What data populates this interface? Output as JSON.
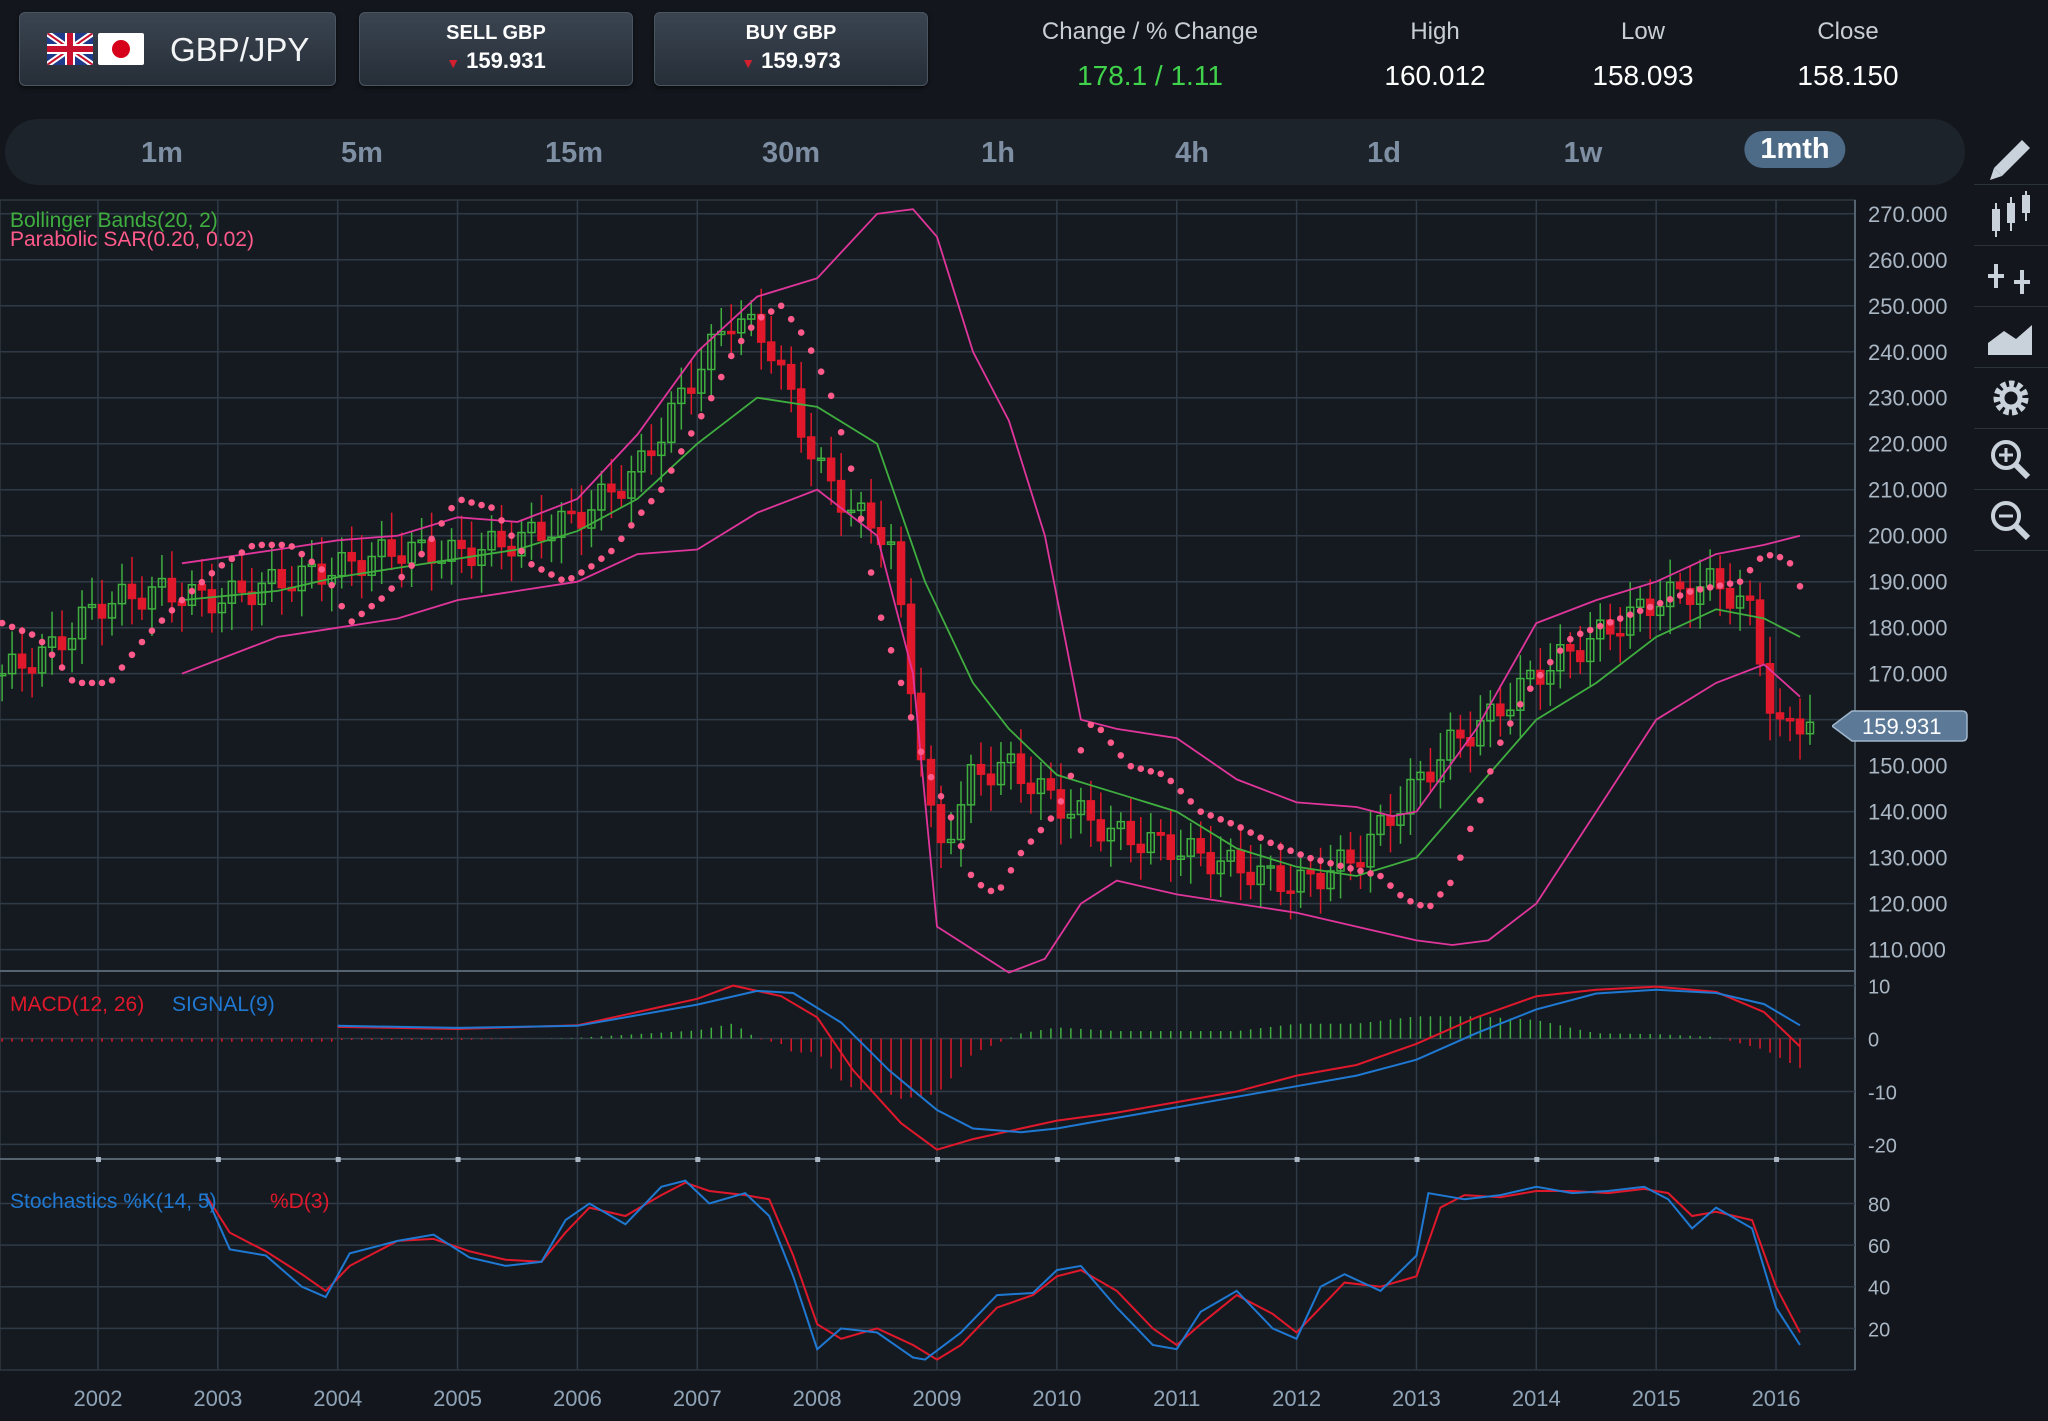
{
  "header": {
    "pair": "GBP/JPY",
    "sell_label": "SELL GBP",
    "sell_price": "159.931",
    "buy_label": "BUY GBP",
    "buy_price": "159.973",
    "change_label": "Change / % Change",
    "change_value": "178.1 / 1.11",
    "high_label": "High",
    "high_value": "160.012",
    "low_label": "Low",
    "low_value": "158.093",
    "close_label": "Close",
    "close_value": "158.150"
  },
  "timeframes": [
    "1m",
    "5m",
    "15m",
    "30m",
    "1h",
    "4h",
    "1d",
    "1w",
    "1mth"
  ],
  "active_timeframe": "1mth",
  "tools": [
    "pencil-icon",
    "candlestick-icon",
    "crosshair-icon",
    "area-chart-icon",
    "gear-icon",
    "zoom-in-icon",
    "zoom-out-icon"
  ],
  "colors": {
    "up": "#3fae3f",
    "down": "#e0182b",
    "bollinger_outer": "#e0359a",
    "bollinger_mid": "#3fae3f",
    "sar": "#ff5a8a",
    "macd": "#e0182b",
    "signal": "#1f78d1",
    "stoch_k": "#1f78d1",
    "stoch_d": "#e0182b"
  },
  "chart_data": {
    "type": "candlestick",
    "current_price_label": "159.931",
    "price_panel": {
      "legend": [
        "Bollinger Bands(20, 2)",
        "Parabolic SAR(0.20, 0.02)"
      ],
      "y_ticks": [
        "270.000",
        "260.000",
        "250.000",
        "240.000",
        "230.000",
        "220.000",
        "210.000",
        "200.000",
        "190.000",
        "180.000",
        "170.000",
        "160.000",
        "150.000",
        "140.000",
        "130.000",
        "120.000",
        "110.000"
      ],
      "ylim": [
        106,
        273
      ],
      "x_ticks": [
        "2002",
        "2003",
        "2004",
        "2005",
        "2006",
        "2007",
        "2008",
        "2009",
        "2010",
        "2011",
        "2012",
        "2013",
        "2014",
        "2015",
        "2016"
      ],
      "xlim": [
        2001.2,
        2016.5
      ],
      "close_series": {
        "x": [
          2001.2,
          2001.6,
          2002.0,
          2002.5,
          2003.0,
          2003.5,
          2004.0,
          2004.5,
          2005.0,
          2005.5,
          2006.0,
          2006.5,
          2007.0,
          2007.3,
          2007.6,
          2008.0,
          2008.3,
          2008.6,
          2008.8,
          2009.0,
          2009.3,
          2009.6,
          2010.0,
          2010.5,
          2011.0,
          2011.5,
          2012.0,
          2012.5,
          2013.0,
          2013.3,
          2013.6,
          2014.0,
          2014.5,
          2015.0,
          2015.5,
          2015.8,
          2016.0,
          2016.2
        ],
        "y": [
          170,
          175,
          185,
          188,
          186,
          190,
          193,
          197,
          196,
          199,
          204,
          214,
          236,
          248,
          242,
          215,
          205,
          200,
          165,
          130,
          148,
          150,
          142,
          135,
          132,
          128,
          124,
          130,
          146,
          155,
          160,
          170,
          178,
          186,
          190,
          183,
          157,
          160
        ]
      },
      "bollinger_upper": {
        "x": [
          2002.7,
          2003.5,
          2004.0,
          2004.5,
          2005.0,
          2005.5,
          2006.0,
          2006.5,
          2007.0,
          2007.5,
          2008.0,
          2008.5,
          2008.8,
          2009.0,
          2009.3,
          2009.6,
          2009.9,
          2010.2,
          2010.5,
          2011.0,
          2011.5,
          2012.0,
          2012.5,
          2012.8,
          2013.0,
          2013.5,
          2014.0,
          2014.5,
          2015.0,
          2015.5,
          2015.9,
          2016.2
        ],
        "y": [
          194,
          197,
          199,
          200,
          204,
          203,
          208,
          222,
          240,
          252,
          256,
          270,
          271,
          265,
          240,
          225,
          200,
          160,
          158,
          156,
          147,
          142,
          141,
          139,
          140,
          158,
          181,
          186,
          190,
          196,
          198,
          200
        ]
      },
      "bollinger_mid": {
        "x": [
          2002.7,
          2003.5,
          2004.0,
          2004.5,
          2005.0,
          2005.5,
          2006.0,
          2006.5,
          2007.0,
          2007.5,
          2008.0,
          2008.5,
          2008.9,
          2009.3,
          2009.6,
          2010.0,
          2010.5,
          2011.0,
          2011.5,
          2012.0,
          2012.5,
          2013.0,
          2013.5,
          2014.0,
          2014.5,
          2015.0,
          2015.5,
          2015.9,
          2016.2
        ],
        "y": [
          186,
          188,
          191,
          193,
          195,
          197,
          201,
          208,
          220,
          230,
          228,
          220,
          190,
          168,
          158,
          148,
          144,
          140,
          132,
          128,
          126,
          130,
          145,
          160,
          168,
          178,
          184,
          182,
          178
        ]
      },
      "bollinger_lower": {
        "x": [
          2002.7,
          2003.5,
          2004.0,
          2004.5,
          2005.0,
          2005.5,
          2006.0,
          2006.5,
          2007.0,
          2007.5,
          2008.0,
          2008.5,
          2008.8,
          2009.0,
          2009.3,
          2009.6,
          2009.9,
          2010.2,
          2010.5,
          2011.0,
          2011.5,
          2012.0,
          2012.5,
          2013.0,
          2013.3,
          2013.6,
          2014.0,
          2014.5,
          2015.0,
          2015.5,
          2015.9,
          2016.2
        ],
        "y": [
          170,
          178,
          180,
          182,
          186,
          188,
          190,
          196,
          197,
          205,
          210,
          200,
          170,
          115,
          110,
          105,
          108,
          120,
          125,
          122,
          120,
          118,
          115,
          112,
          111,
          112,
          120,
          140,
          160,
          168,
          172,
          165
        ]
      },
      "sar": {
        "x": [
          2001.2,
          2001.5,
          2001.8,
          2002.1,
          2002.4,
          2002.7,
          2003.0,
          2003.3,
          2003.6,
          2003.9,
          2004.1,
          2004.4,
          2004.7,
          2005.0,
          2005.3,
          2005.6,
          2005.9,
          2006.1,
          2006.3,
          2006.5,
          2006.7,
          2006.9,
          2007.1,
          2007.3,
          2007.5,
          2007.7,
          2007.9,
          2008.1,
          2008.3,
          2008.5,
          2008.7,
          2008.9,
          2009.1,
          2009.3,
          2009.5,
          2009.7,
          2010.0,
          2010.3,
          2010.6,
          2010.9,
          2011.2,
          2011.5,
          2011.8,
          2012.1,
          2012.4,
          2012.7,
          2012.9,
          2013.1,
          2013.3,
          2013.5,
          2013.7,
          2013.9,
          2014.1,
          2014.3,
          2014.5,
          2014.7,
          2014.9,
          2015.1,
          2015.3,
          2015.5,
          2015.7,
          2015.9,
          2016.1,
          2016.2
        ],
        "y": [
          181,
          178,
          168,
          168,
          178,
          186,
          193,
          198,
          198,
          192,
          181,
          187,
          196,
          208,
          206,
          194,
          190,
          193,
          197,
          204,
          210,
          220,
          229,
          240,
          247,
          250,
          243,
          232,
          213,
          185,
          168,
          150,
          140,
          125,
          122,
          131,
          140,
          160,
          150,
          148,
          140,
          137,
          133,
          130,
          128,
          126,
          121,
          119,
          125,
          140,
          155,
          165,
          172,
          178,
          180,
          182,
          184,
          186,
          188,
          189,
          190,
          196,
          195,
          189
        ]
      }
    },
    "macd_panel": {
      "legend": [
        "MACD(12, 26)",
        "SIGNAL(9)"
      ],
      "y_ticks": [
        "10",
        "0",
        "-10",
        "-20"
      ],
      "ylim": [
        -22,
        12
      ],
      "macd": {
        "x": [
          2004.0,
          2005.0,
          2006.0,
          2007.0,
          2007.3,
          2007.7,
          2008.0,
          2008.3,
          2008.7,
          2009.0,
          2009.3,
          2009.7,
          2010.0,
          2010.5,
          2011.0,
          2011.5,
          2012.0,
          2012.5,
          2013.0,
          2013.5,
          2014.0,
          2014.5,
          2015.0,
          2015.5,
          2015.9,
          2016.2
        ],
        "y": [
          2.2,
          1.8,
          2.5,
          7.5,
          10,
          8,
          4,
          -6,
          -16,
          -21,
          -19,
          -17,
          -15.5,
          -14,
          -12,
          -10,
          -7,
          -5,
          -1,
          4,
          8,
          9.2,
          9.8,
          8.8,
          5,
          -1.5
        ]
      },
      "signal": {
        "x": [
          2004.0,
          2005.0,
          2006.0,
          2007.0,
          2007.5,
          2007.8,
          2008.2,
          2008.6,
          2009.0,
          2009.3,
          2009.7,
          2010.0,
          2010.5,
          2011.0,
          2011.5,
          2012.0,
          2012.5,
          2013.0,
          2013.5,
          2014.0,
          2014.5,
          2015.0,
          2015.5,
          2015.9,
          2016.2
        ],
        "y": [
          2.4,
          2.0,
          2.4,
          6.4,
          9,
          8.6,
          3,
          -6,
          -13.5,
          -17,
          -17.7,
          -17,
          -15,
          -13,
          -11,
          -9,
          -7,
          -4,
          1,
          5.5,
          8.5,
          9.2,
          8.6,
          6.5,
          2.5
        ]
      }
    },
    "stoch_panel": {
      "legend": [
        "Stochastics %K(14, 5)",
        "%D(3)"
      ],
      "y_ticks": [
        "80",
        "60",
        "40",
        "20"
      ],
      "ylim": [
        0,
        98
      ],
      "k": {
        "x": [
          2002.9,
          2003.1,
          2003.4,
          2003.7,
          2003.9,
          2004.1,
          2004.5,
          2004.8,
          2005.1,
          2005.4,
          2005.7,
          2005.9,
          2006.1,
          2006.4,
          2006.7,
          2006.9,
          2007.1,
          2007.4,
          2007.6,
          2007.8,
          2008.0,
          2008.2,
          2008.5,
          2008.8,
          2008.9,
          2009.2,
          2009.5,
          2009.8,
          2010.0,
          2010.2,
          2010.5,
          2010.8,
          2011.0,
          2011.2,
          2011.5,
          2011.8,
          2012.0,
          2012.2,
          2012.4,
          2012.7,
          2013.0,
          2013.1,
          2013.4,
          2013.7,
          2014.0,
          2014.3,
          2014.6,
          2014.9,
          2015.1,
          2015.3,
          2015.5,
          2015.8,
          2016.0,
          2016.2
        ],
        "y": [
          84,
          58,
          55,
          40,
          35,
          56,
          62,
          65,
          54,
          50,
          52,
          72,
          80,
          70,
          88,
          91,
          80,
          85,
          74,
          45,
          10,
          20,
          18,
          6,
          5,
          18,
          36,
          37,
          48,
          50,
          30,
          12,
          10,
          28,
          38,
          20,
          15,
          40,
          46,
          38,
          55,
          85,
          82,
          84,
          88,
          85,
          86,
          88,
          82,
          68,
          78,
          68,
          30,
          12
        ]
      },
      "d": {
        "x": [
          2002.9,
          2003.1,
          2003.4,
          2003.7,
          2003.9,
          2004.1,
          2004.5,
          2004.8,
          2005.1,
          2005.4,
          2005.7,
          2005.9,
          2006.1,
          2006.4,
          2006.7,
          2006.9,
          2007.1,
          2007.4,
          2007.6,
          2007.8,
          2008.0,
          2008.2,
          2008.5,
          2008.8,
          2009.0,
          2009.2,
          2009.5,
          2009.8,
          2010.0,
          2010.2,
          2010.5,
          2010.8,
          2011.0,
          2011.2,
          2011.5,
          2011.8,
          2012.0,
          2012.2,
          2012.4,
          2012.7,
          2013.0,
          2013.2,
          2013.4,
          2013.7,
          2014.0,
          2014.3,
          2014.6,
          2014.9,
          2015.1,
          2015.3,
          2015.5,
          2015.8,
          2016.0,
          2016.2
        ],
        "y": [
          84,
          66,
          57,
          46,
          38,
          50,
          62,
          63,
          57,
          53,
          52,
          66,
          78,
          74,
          84,
          90,
          86,
          84,
          82,
          55,
          22,
          15,
          20,
          12,
          5,
          12,
          30,
          36,
          45,
          48,
          38,
          20,
          12,
          22,
          36,
          27,
          18,
          30,
          42,
          40,
          45,
          78,
          84,
          83,
          86,
          86,
          85,
          87,
          85,
          74,
          76,
          72,
          40,
          18
        ]
      }
    }
  }
}
